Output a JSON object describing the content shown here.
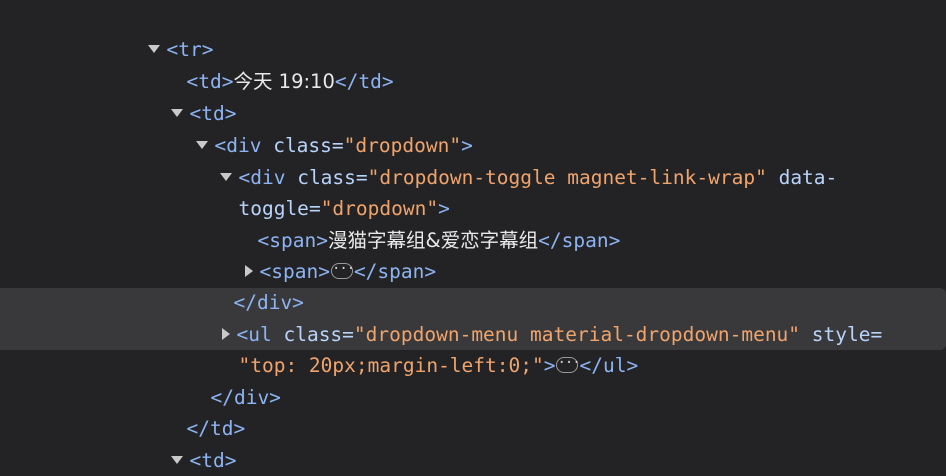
{
  "lines": [
    {
      "open": "<tr",
      "close": ">"
    },
    {
      "open": "<td",
      "close": ">",
      "text": "今天 19:10",
      "end": "</td>"
    },
    {
      "open": "<td",
      "close": ">"
    },
    {
      "open": "<div",
      "attr": "class",
      "eq": "=",
      "value": "\"dropdown\"",
      "close": ">"
    },
    {
      "open": "<div",
      "attr": "class",
      "eq": "=",
      "value": "\"dropdown-toggle magnet-link-wrap\"",
      "attr2": "data-"
    },
    {
      "attr": "toggle",
      "eq": "=",
      "value": "\"dropdown\"",
      "close": ">"
    },
    {
      "open": "<span",
      "close": ">",
      "text": "漫猫字幕组&爱恋字幕组",
      "end": "</span>"
    },
    {
      "open": "<span",
      "close": ">",
      "ellipsis": "···",
      "end": "</span>"
    },
    {
      "end": "</div>"
    },
    {
      "open": "<ul",
      "attr": "class",
      "eq": "=",
      "value": "\"dropdown-menu material-dropdown-menu\"",
      "attr2": "style",
      "eq2": "="
    },
    {
      "value": "\"top: 20px;margin-left:0;\"",
      "close": ">",
      "ellipsis": "···",
      "end": "</ul>"
    },
    {
      "end": "</div>"
    },
    {
      "end": "</td>"
    },
    {
      "open": "<td",
      "close": ">"
    }
  ]
}
